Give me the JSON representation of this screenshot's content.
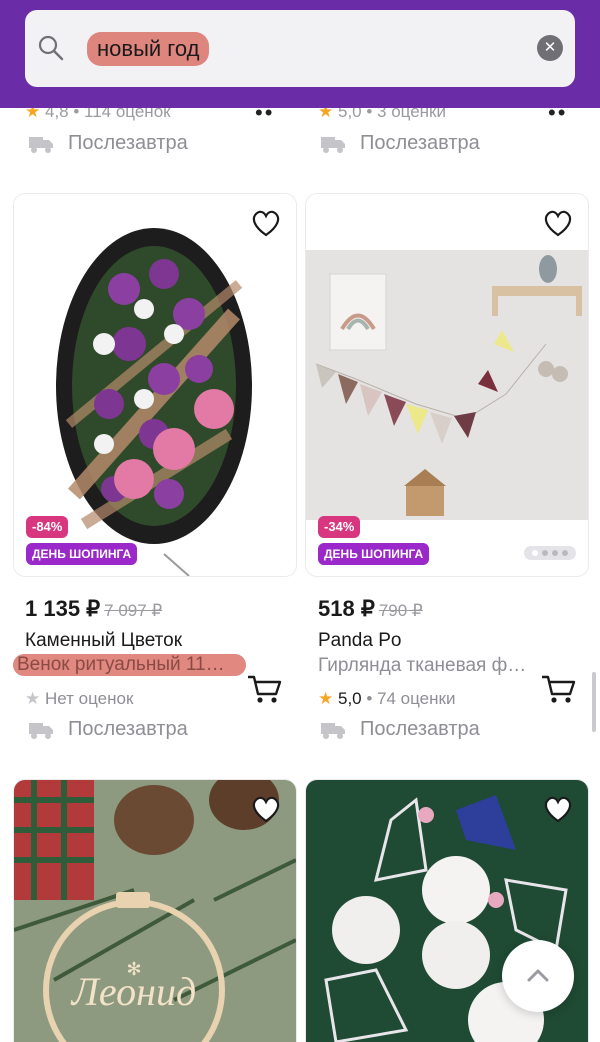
{
  "search": {
    "query": "новый год",
    "clear_icon": "close-icon"
  },
  "top_row": {
    "left": {
      "rating": "4,8",
      "reviews": "114 оценок",
      "delivery": "Послезавтра"
    },
    "right": {
      "rating": "5,0",
      "reviews": "3 оценки",
      "delivery": "Послезавтра"
    }
  },
  "products": [
    {
      "discount": "-84%",
      "promo": "ДЕНЬ ШОПИНГА",
      "price": "1 135 ₽",
      "old_price": "7 097 ₽",
      "brand": "Каменный Цветок",
      "title": "Венок ритуальный 11…",
      "rating_text": "Нет оценок",
      "delivery": "Послезавтра"
    },
    {
      "discount": "-34%",
      "promo": "ДЕНЬ ШОПИНГА",
      "price": "518 ₽",
      "old_price": "790 ₽",
      "brand": "Panda Po",
      "title": "Гирлянда тканевая ф…",
      "rating": "5,0",
      "reviews": "74 оценки",
      "delivery": "Послезавтра"
    }
  ],
  "bottom_cards": {
    "left_ornament_text": "Леонид"
  },
  "colors": {
    "header": "#6b2ca8",
    "discount": "#d8377f",
    "promo": "#9b28c8",
    "star": "#f5a623"
  }
}
